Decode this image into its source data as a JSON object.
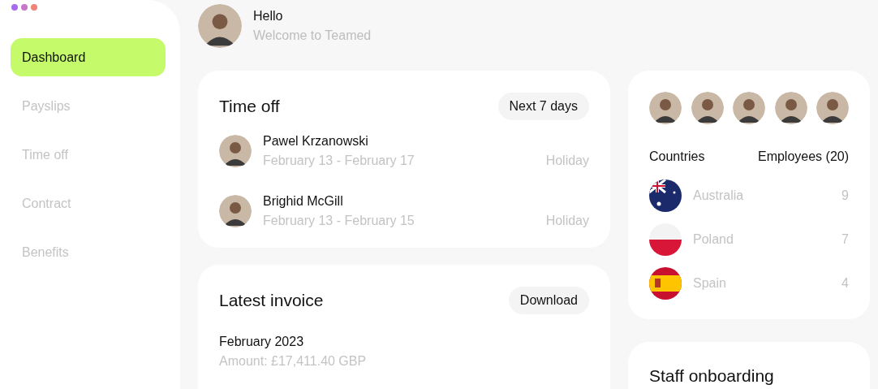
{
  "window_controls": [
    {
      "color": "#a66cf0"
    },
    {
      "color": "#c777c9"
    },
    {
      "color": "#f08478"
    }
  ],
  "sidebar": {
    "items": [
      {
        "label": "Dashboard",
        "selected": true
      },
      {
        "label": "Payslips",
        "selected": false
      },
      {
        "label": "Time off",
        "selected": false
      },
      {
        "label": "Contract",
        "selected": false
      },
      {
        "label": "Benefits",
        "selected": false
      }
    ]
  },
  "header": {
    "avatar": {
      "kind": "picture"
    },
    "greeting": "Hello",
    "subtitle": "Welcome to Teamed"
  },
  "time_off": {
    "title": "Time off",
    "filter": "Next 7 days",
    "entries": [
      {
        "avatar": {
          "kind": "picture"
        },
        "name": "Pawel Krzanowski",
        "dates": "February 13 - February 17",
        "type": "Holiday"
      },
      {
        "avatar": {
          "kind": "picture"
        },
        "name": "Brighid McGill",
        "dates": "February 13 - February 15",
        "type": "Holiday"
      }
    ]
  },
  "latest_invoice": {
    "title": "Latest invoice",
    "action": "Download",
    "period": "February 2023",
    "amount": "Amount: £17,411.40 GBP"
  },
  "team": {
    "avatars": [
      {
        "kind": "picture"
      },
      {
        "kind": "picture"
      },
      {
        "kind": "picture"
      },
      {
        "kind": "picture"
      },
      {
        "kind": "picture"
      }
    ],
    "columns": [
      "Countries",
      "Employees (20)"
    ],
    "countries": [
      {
        "kind": "au",
        "name": "Australia",
        "count": "9"
      },
      {
        "kind": "pl",
        "name": "Poland",
        "count": "7"
      },
      {
        "kind": "es",
        "name": "Spain",
        "count": "4"
      }
    ]
  },
  "staff_onboarding": {
    "title": "Staff onboarding"
  }
}
